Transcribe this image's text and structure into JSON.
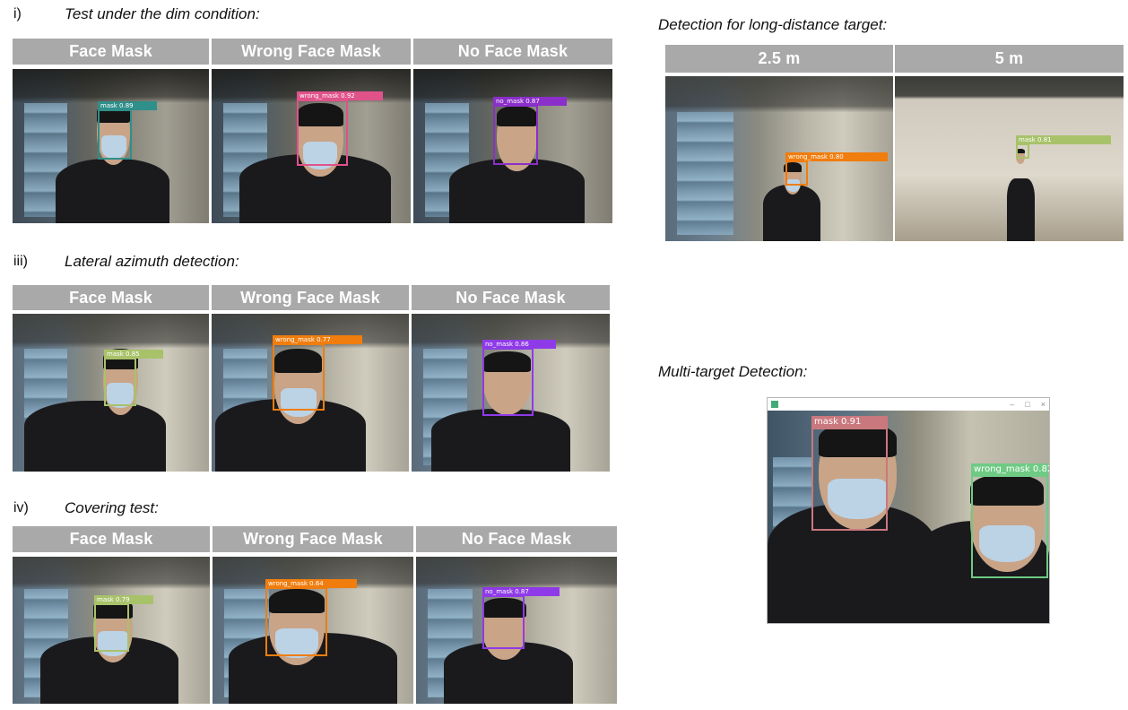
{
  "sections": {
    "dim": {
      "label": "i)",
      "title": "Test under the dim condition:",
      "headers": [
        "Face Mask",
        "Wrong Face Mask",
        "No Face Mask"
      ],
      "detections": [
        {
          "text": "mask 0.89",
          "color": "#2f8f8a"
        },
        {
          "text": "wrong_mask 0.92",
          "color": "#e0528a"
        },
        {
          "text": "no_mask 0.87",
          "color": "#8a2fc9"
        }
      ]
    },
    "lateral": {
      "label": "iii)",
      "title": "Lateral azimuth detection:",
      "headers": [
        "Face Mask",
        "Wrong Face Mask",
        "No Face Mask"
      ],
      "detections": [
        {
          "text": "mask 0.85",
          "color": "#a8c26a"
        },
        {
          "text": "wrong_mask 0.77",
          "color": "#f07d0e"
        },
        {
          "text": "no_mask 0.86",
          "color": "#8f3ae8"
        }
      ]
    },
    "covering": {
      "label": "iv)",
      "title": "Covering test:",
      "headers": [
        "Face Mask",
        "Wrong Face Mask",
        "No Face Mask"
      ],
      "detections": [
        {
          "text": "mask 0.79",
          "color": "#a8c26a"
        },
        {
          "text": "wrong_mask 0.64",
          "color": "#f07d0e"
        },
        {
          "text": "no_mask 0.87",
          "color": "#8f3ae8"
        }
      ]
    },
    "distance": {
      "title": "Detection for long-distance target:",
      "headers": [
        "2.5 m",
        "5 m"
      ],
      "detections": [
        {
          "text": "wrong_mask 0.80",
          "color": "#f07d0e"
        },
        {
          "text": "mask 0.81",
          "color": "#a8c26a"
        }
      ]
    },
    "multi": {
      "title": "Multi-target Detection:",
      "window_controls": [
        "–",
        "□",
        "×"
      ],
      "detections": [
        {
          "text": "mask 0.91",
          "color": "#c9787e"
        },
        {
          "text": "wrong_mask 0.82",
          "color": "#6fca84"
        }
      ]
    }
  }
}
